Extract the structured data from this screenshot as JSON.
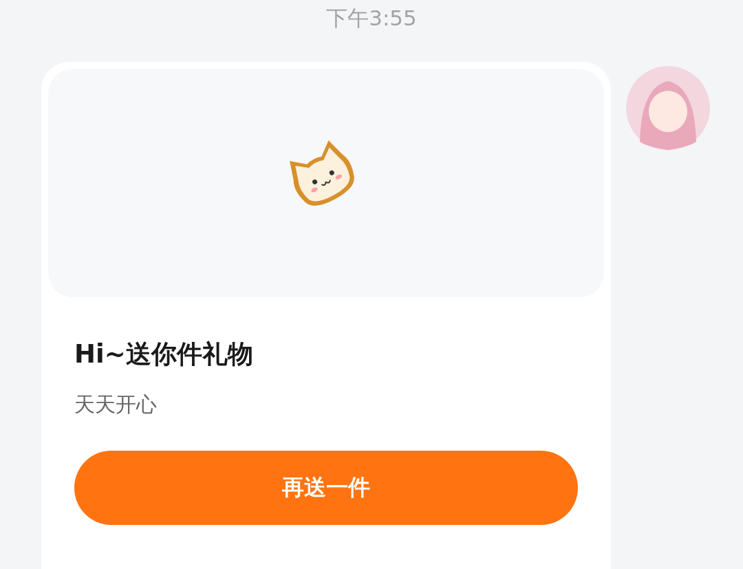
{
  "timestamp": "下午3:55",
  "gift_card": {
    "title": "Hi~送你件礼物",
    "message": "天天开心",
    "button": "再送一件"
  }
}
